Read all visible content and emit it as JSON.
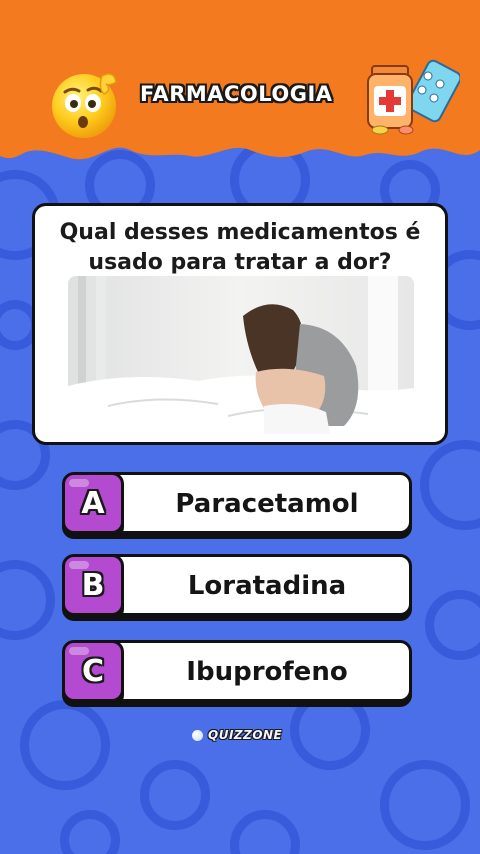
{
  "header": {
    "title": "FARMACOLOGIA",
    "left_icon": "confused-face-emoji-icon",
    "right_icon": "medicine-pills-icon",
    "color": "#f37a1f"
  },
  "question": {
    "line1": "Qual desses medicamentos é",
    "line2": "usado para tratar a dor?",
    "image": "woman-sitting-in-bed-in-pain"
  },
  "answers": [
    {
      "letter": "A",
      "text": "Paracetamol"
    },
    {
      "letter": "B",
      "text": "Loratadina"
    },
    {
      "letter": "C",
      "text": "Ibuprofeno"
    }
  ],
  "footer": {
    "brand": "QUIZZONE"
  },
  "colors": {
    "background": "#4a6fe8",
    "header": "#f37a1f",
    "letter_badge": "#b34ad0"
  }
}
